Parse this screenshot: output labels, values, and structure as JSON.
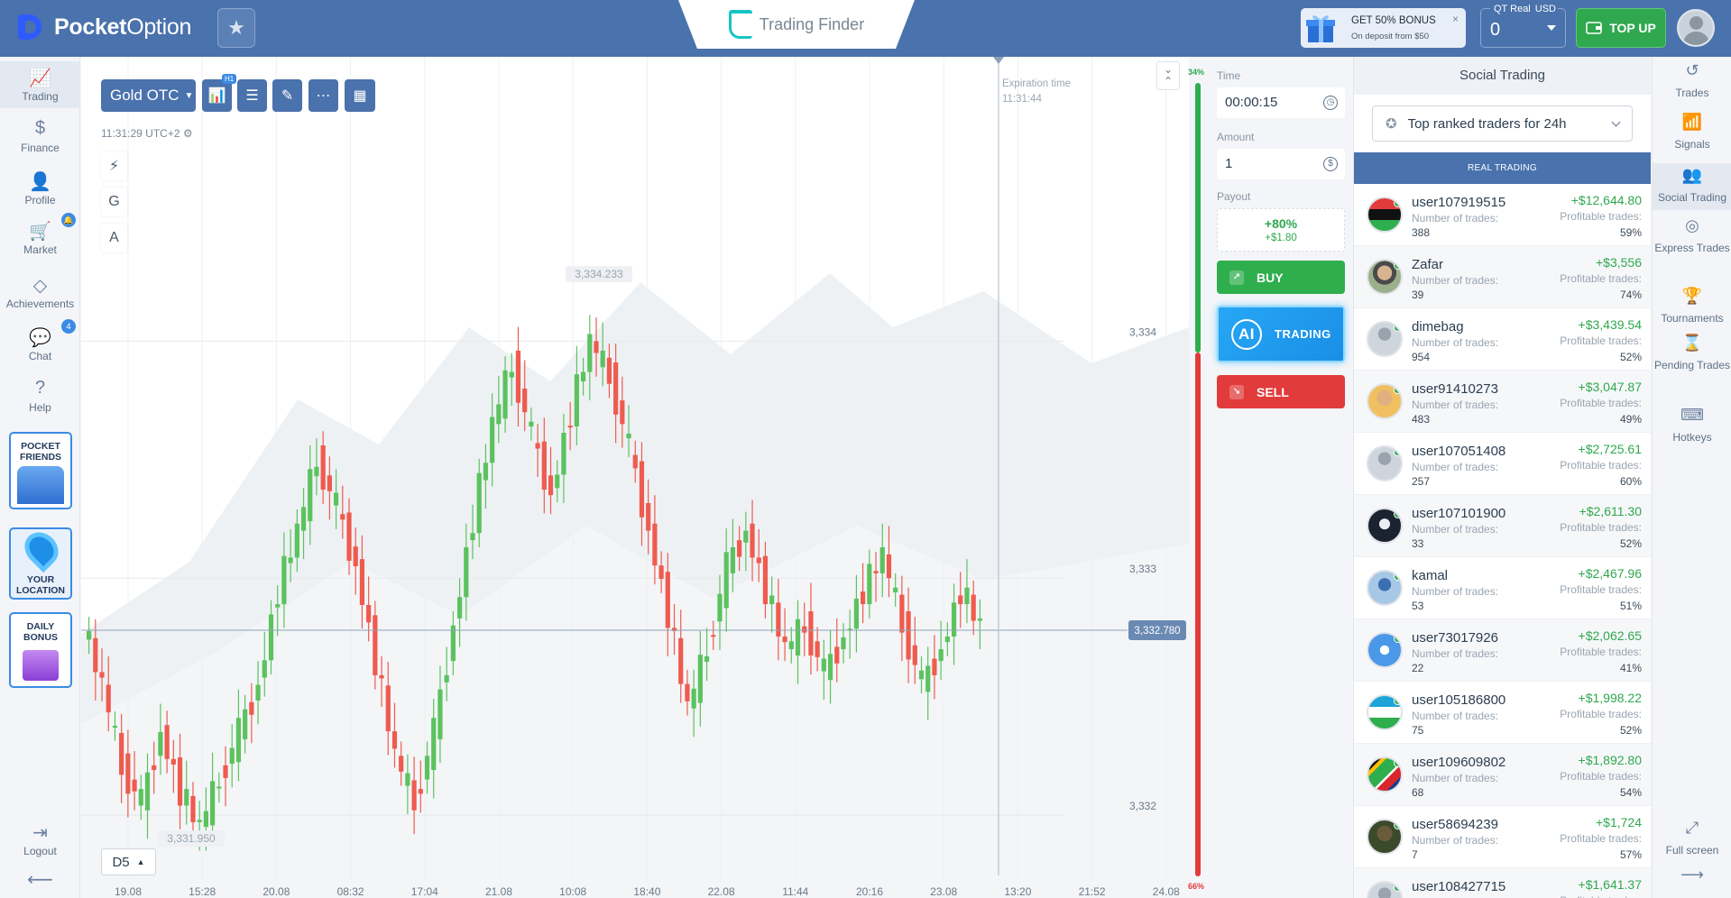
{
  "brand": {
    "name_bold": "Pocket",
    "name_regular": "Option"
  },
  "watermark": {
    "text": "Trading Finder"
  },
  "bonus": {
    "title": "GET 50% BONUS",
    "subtitle": "On deposit from $50",
    "close": "×"
  },
  "account": {
    "label": "QT Real",
    "currency": "USD",
    "balance": "0"
  },
  "topup": {
    "label": "TOP UP"
  },
  "left_nav": [
    {
      "label": "Trading",
      "icon": "chart-icon",
      "active": true
    },
    {
      "label": "Finance",
      "icon": "dollar-icon"
    },
    {
      "label": "Profile",
      "icon": "user-icon"
    },
    {
      "label": "Market",
      "icon": "cart-icon",
      "badge": ""
    },
    {
      "label": "Achievements",
      "icon": "diamond-icon"
    },
    {
      "label": "Chat",
      "icon": "chat-icon",
      "badge": "4"
    },
    {
      "label": "Help",
      "icon": "help-icon"
    }
  ],
  "promos": {
    "friends": "POCKET FRIENDS",
    "location": "YOUR LOCATION",
    "daily": "DAILY BONUS"
  },
  "logout": {
    "label": "Logout"
  },
  "chart": {
    "asset": "Gold OTC",
    "timeframe_badge": "H1",
    "timestamp": "11:31:29 UTC+2",
    "expiration_label": "Expiration time",
    "expiration_time": "11:31:44",
    "tools": [
      "⚡",
      "G",
      "A"
    ],
    "period": "D5",
    "high_label": "3,334.233",
    "low_label": "3,331.950",
    "current_price": "3,332.780",
    "pct_up": "34%",
    "pct_down": "66%"
  },
  "chart_data": {
    "type": "candlestick",
    "title": "",
    "y_ticks": [
      "3,334",
      "3,333",
      "3,332"
    ],
    "y_tick_values": [
      3334,
      3333,
      3332
    ],
    "x_ticks": [
      "19.08",
      "15:28",
      "20.08",
      "08:32",
      "17:04",
      "21.08",
      "10:08",
      "18:40",
      "22.08",
      "11:44",
      "20:16",
      "23.08",
      "13:20",
      "21:52",
      "24.08"
    ],
    "ylim": [
      3331.65,
      3335.2
    ],
    "current_price": 3332.78,
    "high": 3334.233,
    "low": 3331.95,
    "candles_close": [
      3332.8,
      3332.55,
      3332.2,
      3332.05,
      3332.35,
      3332.1,
      3331.95,
      3332.15,
      3332.35,
      3332.55,
      3332.95,
      3333.2,
      3333.5,
      3333.3,
      3333.05,
      3332.65,
      3332.25,
      3332.05,
      3332.35,
      3332.8,
      3333.25,
      3333.65,
      3333.9,
      3333.6,
      3333.35,
      3333.7,
      3334.0,
      3333.85,
      3333.55,
      3333.2,
      3332.85,
      3332.45,
      3332.7,
      3333.05,
      3333.2,
      3332.95,
      3332.7,
      3332.8,
      3332.6,
      3332.75,
      3332.95,
      3333.1,
      3332.8,
      3332.55,
      3332.7,
      3332.95,
      3332.8
    ]
  },
  "trade": {
    "time_label": "Time",
    "time_value": "00:00:15",
    "amount_label": "Amount",
    "amount_value": "1",
    "payout_label": "Payout",
    "payout_pct": "+80%",
    "payout_amount": "+$1.80",
    "buy": "BUY",
    "ai_logo": "AI",
    "ai_text": "TRADING",
    "sell": "SELL"
  },
  "social": {
    "title": "Social Trading",
    "filter": "Top ranked traders for 24h",
    "section": "REAL TRADING",
    "trades_label": "Number of trades:",
    "profit_label": "Profitable trades:",
    "traders": [
      {
        "name": "user107919515",
        "trades": "388",
        "profit": "+$12,644.80",
        "pct": "59%",
        "flag": "libya"
      },
      {
        "name": "Zafar",
        "trades": "39",
        "profit": "+$3,556",
        "pct": "74%",
        "flag": "photo"
      },
      {
        "name": "dimebag",
        "trades": "954",
        "profit": "+$3,439.54",
        "pct": "52%",
        "flag": "default"
      },
      {
        "name": "user91410273",
        "trades": "483",
        "profit": "+$3,047.87",
        "pct": "49%",
        "flag": "photo2"
      },
      {
        "name": "user107051408",
        "trades": "257",
        "profit": "+$2,725.61",
        "pct": "60%",
        "flag": "default"
      },
      {
        "name": "user107101900",
        "trades": "33",
        "profit": "+$2,611.30",
        "pct": "52%",
        "flag": "dark"
      },
      {
        "name": "kamal",
        "trades": "53",
        "profit": "+$2,467.96",
        "pct": "51%",
        "flag": "photo3"
      },
      {
        "name": "user73017926",
        "trades": "22",
        "profit": "+$2,062.65",
        "pct": "41%",
        "flag": "somalia"
      },
      {
        "name": "user105186800",
        "trades": "75",
        "profit": "+$1,998.22",
        "pct": "52%",
        "flag": "uzbekistan"
      },
      {
        "name": "user109609802",
        "trades": "68",
        "profit": "+$1,892.80",
        "pct": "54%",
        "flag": "south-africa"
      },
      {
        "name": "user58694239",
        "trades": "7",
        "profit": "+$1,724",
        "pct": "57%",
        "flag": "photo4"
      },
      {
        "name": "user108427715",
        "trades": "",
        "profit": "+$1,641.37",
        "pct": "",
        "flag": "default"
      }
    ]
  },
  "right_nav": [
    {
      "label": "Trades",
      "icon": "history-icon"
    },
    {
      "label": "Signals",
      "icon": "signal-icon"
    },
    {
      "label": "Social Trading",
      "icon": "people-icon",
      "active": true
    },
    {
      "label": "Express Trades",
      "icon": "target-icon"
    },
    {
      "label": "Tournaments",
      "icon": "trophy-icon"
    },
    {
      "label": "Pending Trades",
      "icon": "hourglass-icon"
    },
    {
      "label": "Hotkeys",
      "icon": "keyboard-icon"
    }
  ],
  "fullscreen": {
    "label": "Full screen"
  },
  "colors": {
    "header": "#4a72ac",
    "up": "#5cc25f",
    "down": "#ef5b4f",
    "buy": "#2fae4e",
    "sell": "#e23b3b"
  }
}
